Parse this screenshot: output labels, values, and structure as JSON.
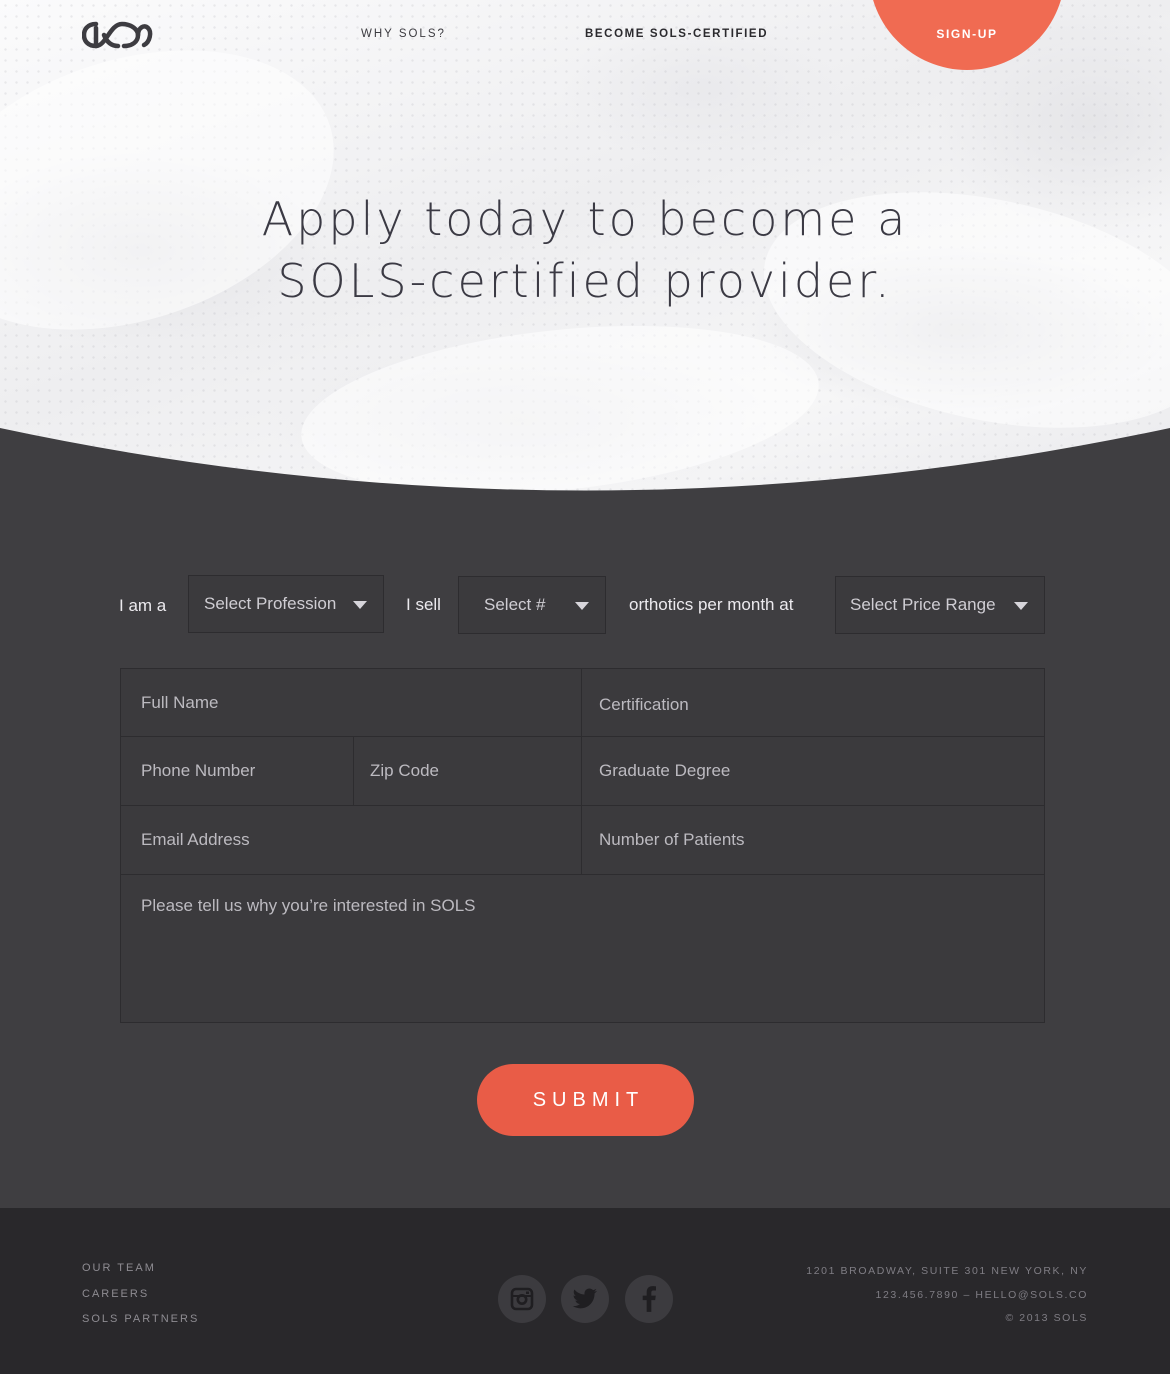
{
  "nav": {
    "why": "WHY SOLS?",
    "become": "BECOME SOLS-CERTIFIED",
    "signup": "SIGN-UP",
    "logo_icon": "sols-infinity-logo"
  },
  "hero": {
    "line1": "Apply today to become a",
    "line2": "SOLS-certified provider."
  },
  "form": {
    "label_i_am": "I am a",
    "profession_select": "Select Profession",
    "label_i_sell": "I sell",
    "number_select": "Select #",
    "label_per_month": "orthotics per month at",
    "price_select": "Select Price Range",
    "full_name": "Full Name",
    "certification": "Certification",
    "phone": "Phone Number",
    "zip": "Zip Code",
    "graduate_degree": "Graduate Degree",
    "email": "Email Address",
    "patients": "Number of Patients",
    "interest": "Please tell us why you’re interested in SOLS",
    "submit": "SUBMIT"
  },
  "footer": {
    "links": [
      "OUR TEAM",
      "CAREERS",
      "SOLS PARTNERS"
    ],
    "social": [
      "instagram-icon",
      "twitter-icon",
      "facebook-icon"
    ],
    "address": "1201 BROADWAY, SUITE 301 NEW YORK, NY",
    "contact": "123.456.7890 – HELLO@SOLS.CO",
    "copyright": "© 2013 SOLS"
  },
  "colors": {
    "accent": "#f06b52",
    "submit": "#e95c47",
    "form_bg": "#3f3e41",
    "footer_bg": "#29282b"
  }
}
